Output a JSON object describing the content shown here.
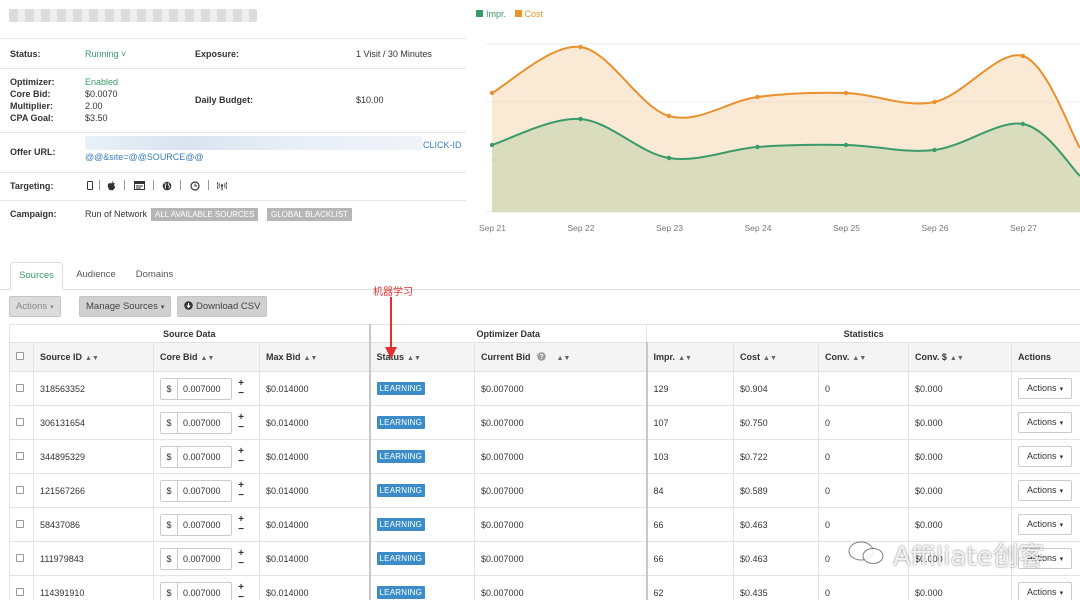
{
  "info": {
    "status_label": "Status:",
    "status_value": "Running",
    "status_caret": "˅",
    "exposure_label": "Exposure:",
    "exposure_value": "1 Visit / 30 Minutes",
    "optimizer_label": "Optimizer:",
    "optimizer_value": "Enabled",
    "core_bid_label": "Core Bid:",
    "core_bid_value": "$0.0070",
    "multiplier_label": "Multiplier:",
    "multiplier_value": "2.00",
    "cpa_goal_label": "CPA Goal:",
    "cpa_goal_value": "$3.50",
    "daily_budget_label": "Daily Budget:",
    "daily_budget_value": "$10.00",
    "offer_url_label": "Offer URL:",
    "offer_url_end": "CLICK-ID",
    "offer_url_line2": "@@&site=@@SOURCE@@",
    "targeting_label": "Targeting:",
    "campaign_label": "Campaign:",
    "campaign_value": "Run of Network",
    "campaign_tags": [
      "ALL AVAILABLE SOURCES",
      "GLOBAL BLACKLIST"
    ]
  },
  "icons": {
    "mobile": "mobile-icon",
    "apple": "apple-icon",
    "browser": "browser-icon",
    "globe": "globe-icon",
    "clock": "clock-icon",
    "wifi": "wifi-icon"
  },
  "colors": {
    "impr": "#3a9a6a",
    "cost": "#e8912d",
    "accent_green": "#3a9a6a",
    "badge_blue": "#3b8cc9",
    "annotation_red": "#e03030"
  },
  "chart_data": {
    "type": "area",
    "categories": [
      "Sep 21",
      "Sep 22",
      "Sep 23",
      "Sep 24",
      "Sep 25",
      "Sep 26",
      "Sep 27"
    ],
    "series": [
      {
        "name": "Impr.",
        "values": [
          145,
          119,
          158,
          147,
          145,
          150,
          124
        ]
      },
      {
        "name": "Cost",
        "values": [
          93,
          47,
          116,
          97,
          93,
          102,
          56
        ]
      }
    ],
    "note_values_are_read_as_inverted_relative_levels": "",
    "grid": true,
    "legend": "top-left"
  },
  "tabs": [
    "Sources",
    "Audience",
    "Domains"
  ],
  "toolbar": {
    "actions": "Actions",
    "manage_sources": "Manage Sources",
    "download_csv": "Download CSV"
  },
  "annotation": "机器学习",
  "table": {
    "groups": [
      "Source Data",
      "Optimizer Data",
      "Statistics"
    ],
    "columns": [
      "Source ID",
      "Core Bid",
      "Max Bid",
      "Status",
      "Current Bid",
      "Impr.",
      "Cost",
      "Conv.",
      "Conv. $",
      "Actions"
    ],
    "rows": [
      {
        "id": "318563352",
        "core_bid": "0.007000",
        "max_bid": "$0.014000",
        "status": "LEARNING",
        "current_bid": "$0.007000",
        "impr": "129",
        "cost": "$0.904",
        "conv": "0",
        "conv_value": "$0.000",
        "action": "Actions"
      },
      {
        "id": "306131654",
        "core_bid": "0.007000",
        "max_bid": "$0.014000",
        "status": "LEARNING",
        "current_bid": "$0.007000",
        "impr": "107",
        "cost": "$0.750",
        "conv": "0",
        "conv_value": "$0.000",
        "action": "Actions"
      },
      {
        "id": "344895329",
        "core_bid": "0.007000",
        "max_bid": "$0.014000",
        "status": "LEARNING",
        "current_bid": "$0.007000",
        "impr": "103",
        "cost": "$0.722",
        "conv": "0",
        "conv_value": "$0.000",
        "action": "Actions"
      },
      {
        "id": "121567266",
        "core_bid": "0.007000",
        "max_bid": "$0.014000",
        "status": "LEARNING",
        "current_bid": "$0.007000",
        "impr": "84",
        "cost": "$0.589",
        "conv": "0",
        "conv_value": "$0.000",
        "action": "Actions"
      },
      {
        "id": "58437086",
        "core_bid": "0.007000",
        "max_bid": "$0.014000",
        "status": "LEARNING",
        "current_bid": "$0.007000",
        "impr": "66",
        "cost": "$0.463",
        "conv": "0",
        "conv_value": "$0.000",
        "action": "Actions"
      },
      {
        "id": "111979843",
        "core_bid": "0.007000",
        "max_bid": "$0.014000",
        "status": "LEARNING",
        "current_bid": "$0.007000",
        "impr": "66",
        "cost": "$0.463",
        "conv": "0",
        "conv_value": "$0.000",
        "action": "Actions"
      },
      {
        "id": "114391910",
        "core_bid": "0.007000",
        "max_bid": "$0.014000",
        "status": "LEARNING",
        "current_bid": "$0.007000",
        "impr": "62",
        "cost": "$0.435",
        "conv": "0",
        "conv_value": "$0.000",
        "action": "Actions"
      }
    ],
    "currency": "$"
  },
  "watermark": "Affiliate创客"
}
